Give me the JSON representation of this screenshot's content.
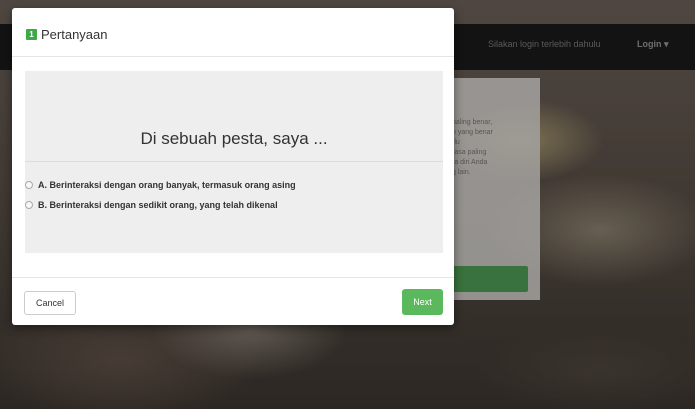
{
  "background": {
    "navbar": {
      "login_prompt": "Silakan login terlebih dahulu",
      "login_label": "Login ▾"
    },
    "panel": {
      "text_lines": [
        "paling benar,",
        "n yang benar",
        "rlu",
        "rasa paling",
        "ra diri Anda",
        "g lain."
      ]
    }
  },
  "modal": {
    "number": "1",
    "title": "Pertanyaan",
    "question": "Di sebuah pesta, saya ...",
    "options": [
      {
        "label": "A. Berinteraksi dengan orang banyak, termasuk orang asing"
      },
      {
        "label": "B. Berinteraksi dengan sedikit orang, yang telah dikenal"
      }
    ],
    "footer": {
      "cancel_label": "Cancel",
      "next_label": "Next"
    }
  },
  "colors": {
    "accent_green": "#5cb85c",
    "badge_green": "#3ea947"
  }
}
